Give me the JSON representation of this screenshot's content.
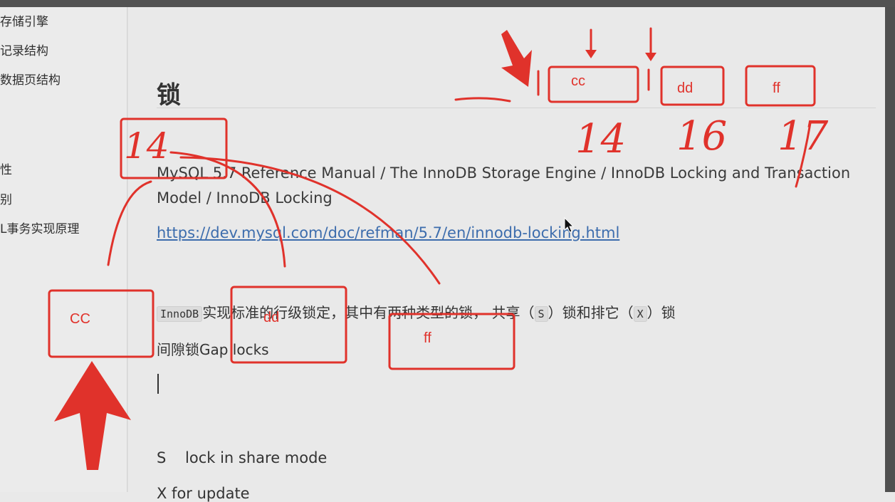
{
  "sidebar": {
    "items": [
      {
        "label": "存储引擎"
      },
      {
        "label": "记录结构"
      },
      {
        "label": "数据页结构"
      },
      {
        "label": "性"
      },
      {
        "label": "别"
      },
      {
        "label": "L事务实现原理"
      }
    ]
  },
  "document": {
    "title": "锁",
    "breadcrumb": "MySQL 5.7 Reference Manual  /  The InnoDB Storage Engine  /  InnoDB Locking and Transaction Model / InnoDB Locking",
    "link": "https://dev.mysql.com/doc/refman/5.7/en/innodb-locking.html",
    "para": {
      "code1": "InnoDB",
      "text1": "实现标准的行级锁定，其中有两种类型的锁， 共享（",
      "code2": "S",
      "text2": "）锁和排它（",
      "code3": "X",
      "text3": "）锁"
    },
    "gap_line": "间隙锁Gap locks",
    "s_line": "S    lock in share mode",
    "cut_line": "X    for update"
  },
  "annotations": {
    "top_boxes": [
      "cc",
      "dd",
      "ff"
    ],
    "top_numbers": [
      "14",
      "16",
      "17"
    ],
    "left_number": "14",
    "lower_boxes": [
      "CC",
      "dd",
      "ff"
    ],
    "color": "#e0322b"
  }
}
